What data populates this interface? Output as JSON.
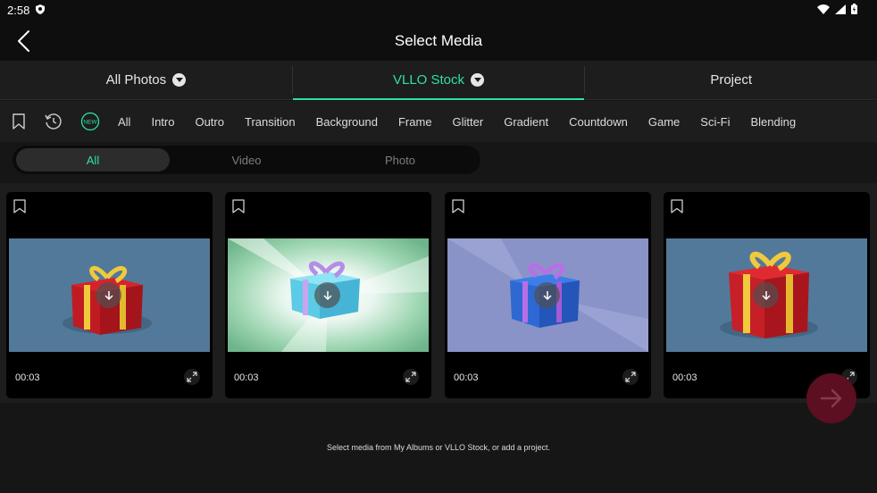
{
  "status": {
    "time": "2:58"
  },
  "header": {
    "title": "Select Media"
  },
  "tabs": [
    {
      "label": "All Photos",
      "dropdown": true
    },
    {
      "label": "VLLO Stock",
      "dropdown": true
    },
    {
      "label": "Project",
      "dropdown": false
    }
  ],
  "active_tab": "VLLO Stock",
  "category_icons": [
    "bookmark-icon",
    "recent-clock-icon",
    "new-badge-icon"
  ],
  "new_badge": "NEW",
  "categories": [
    "All",
    "Intro",
    "Outro",
    "Transition",
    "Background",
    "Frame",
    "Glitter",
    "Gradient",
    "Countdown",
    "Game",
    "Sci-Fi",
    "Blending"
  ],
  "filter": {
    "options": [
      "All",
      "Video",
      "Photo"
    ],
    "selected": "All"
  },
  "cards": [
    {
      "duration": "00:03",
      "gift_color": "red"
    },
    {
      "duration": "00:03",
      "gift_color": "light-blue"
    },
    {
      "duration": "00:03",
      "gift_color": "blue"
    },
    {
      "duration": "00:03",
      "gift_color": "red"
    }
  ],
  "footer": {
    "hint": "Select media from My Albums or VLLO Stock, or add a project."
  },
  "colors": {
    "accent": "#2ee0a6",
    "fab": "#5b0f21"
  }
}
